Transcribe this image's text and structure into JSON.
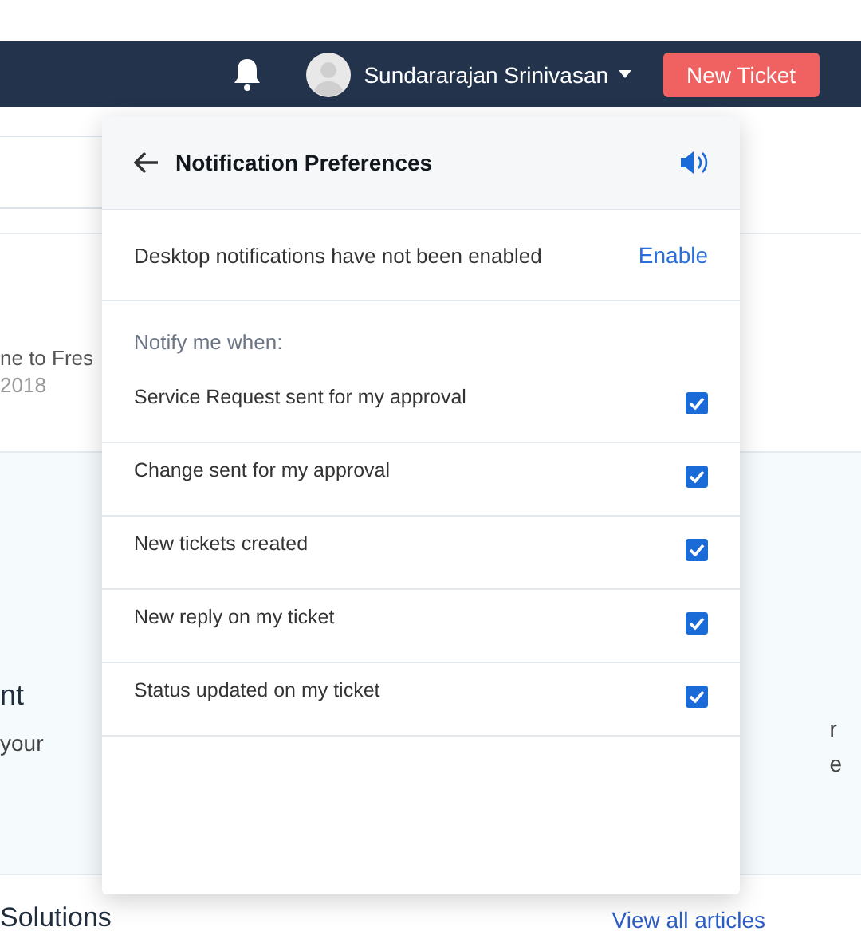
{
  "navbar": {
    "user_name": "Sundararajan Srinivasan",
    "new_ticket_button": "New Ticket"
  },
  "background": {
    "welcome_text": "ne to Fres",
    "date": "2018",
    "card_heading": "nt",
    "card_text": "your",
    "right_text_lines": [
      "r",
      "e"
    ],
    "section_title": "Solutions",
    "section_link": "View all articles"
  },
  "popover": {
    "title": "Notification Preferences",
    "desktop_message": "Desktop notifications have not been enabled",
    "enable_link": "Enable",
    "notify_label": "Notify me when:",
    "options": [
      {
        "label": "Service Request sent for my approval",
        "checked": true
      },
      {
        "label": "Change sent for my approval",
        "checked": true
      },
      {
        "label": "New tickets created",
        "checked": true
      },
      {
        "label": "New reply on my ticket",
        "checked": true
      },
      {
        "label": "Status updated on my ticket",
        "checked": true
      }
    ]
  }
}
